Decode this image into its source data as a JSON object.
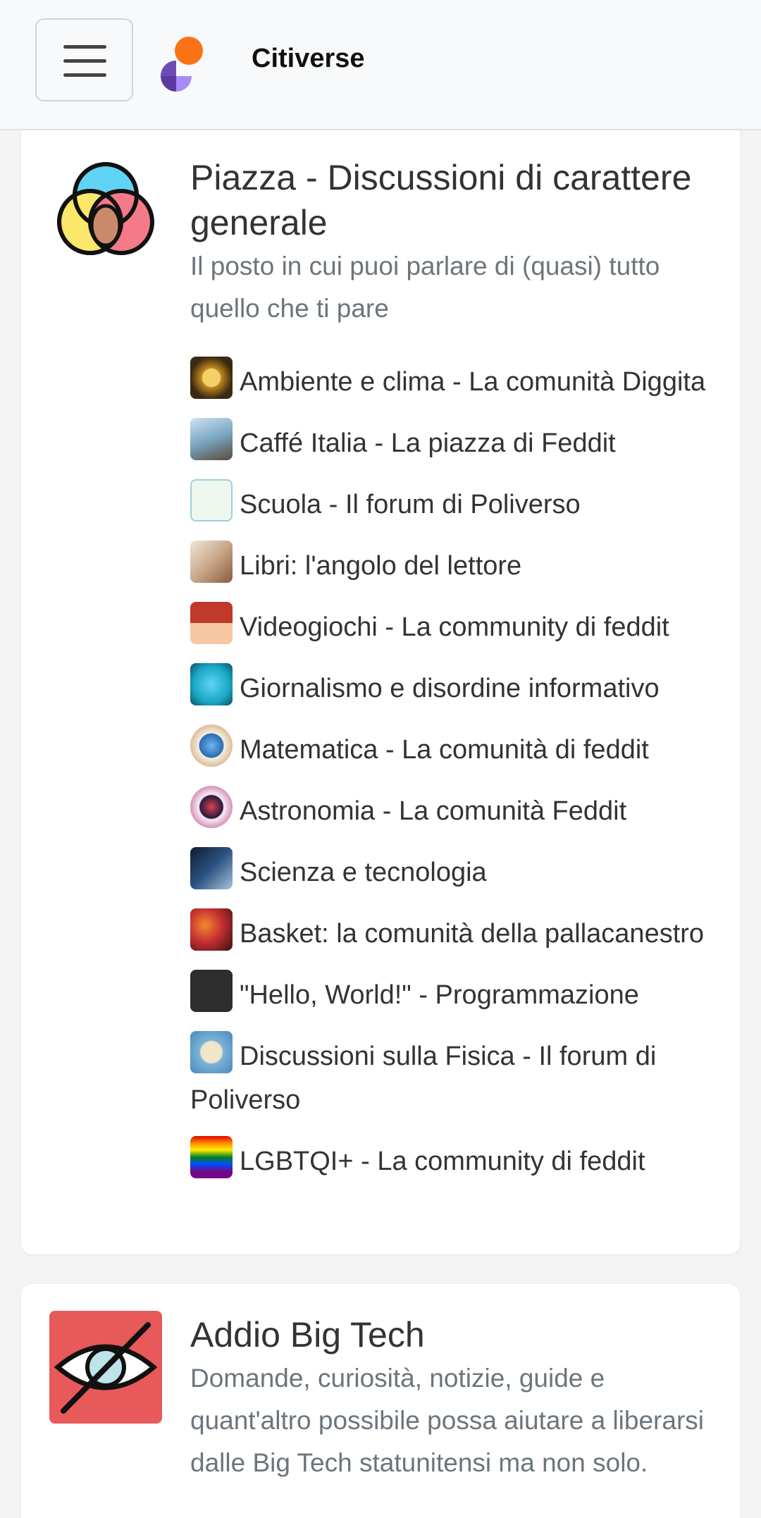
{
  "header": {
    "brand": "Citiverse",
    "colors": {
      "logo_orange": "#f97316",
      "logo_purple": "#5b3aa0",
      "logo_lilac": "#a78bfa"
    }
  },
  "categories": [
    {
      "icon": "venn-diagram-icon",
      "title": "Piazza - Discussioni di carattere generale",
      "description": "Il posto in cui puoi parlare di (quasi) tutto quello che ti pare",
      "subcategories": [
        {
          "label": "Ambiente e clima - La comunità Diggita",
          "icon": "climate-justice-icon",
          "color": "#c58a20"
        },
        {
          "label": "Caffé Italia - La piazza di Feddit",
          "icon": "cafe-photo-icon",
          "color": "#7aa6c2"
        },
        {
          "label": "Scuola - Il forum di Poliverso",
          "icon": "scuola-logo-icon",
          "color": "#2e9d3a"
        },
        {
          "label": "Libri: l'angolo del lettore",
          "icon": "book-icon",
          "color": "#8a5a3c"
        },
        {
          "label": "Videogiochi - La community di feddit",
          "icon": "mushroom-icon",
          "color": "#c0392b"
        },
        {
          "label": "Giornalismo e disordine informativo",
          "icon": "hands-globe-icon",
          "color": "#1aa7c4"
        },
        {
          "label": "Matematica - La comunità di feddit",
          "icon": "pi-badge-icon",
          "color": "#2b6cb0"
        },
        {
          "label": "Astronomia - La comunità Feddit",
          "icon": "astronomy-badge-icon",
          "color": "#b83280"
        },
        {
          "label": "Scienza e tecnologia",
          "icon": "microscope-icon",
          "color": "#2c5282"
        },
        {
          "label": "Basket: la comunità della pallacanestro",
          "icon": "basketball-icon",
          "color": "#c53030"
        },
        {
          "label": "\"Hello, World!\" - Programmazione",
          "icon": "terminal-icon",
          "color": "#2d2d2d"
        },
        {
          "label": "Discussioni sulla Fisica - Il forum di Poliverso",
          "icon": "physics-badge-icon",
          "color": "#7bb3d9"
        },
        {
          "label": "LGBTQI+ - La community di feddit",
          "icon": "pride-flag-icon",
          "color": "#e040a0"
        }
      ]
    },
    {
      "icon": "eye-slash-icon",
      "icon_color": "#e85a5a",
      "title": "Addio Big Tech",
      "description": "Domande, curiosità, notizie, guide e quant'altro possibile possa aiutare a liberarsi dalle Big Tech statunitensi ma non solo."
    }
  ]
}
